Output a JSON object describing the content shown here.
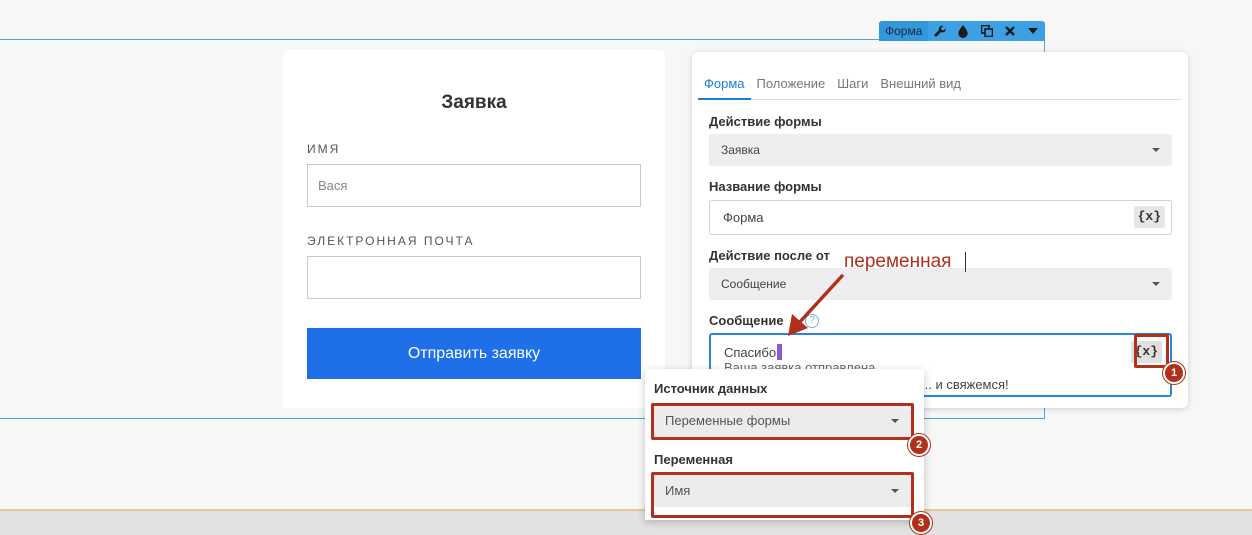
{
  "preview_form": {
    "title": "Заявка",
    "name_label": "ИМЯ",
    "name_value": "Вася",
    "email_label": "ЭЛЕКТРОННАЯ ПОЧТА",
    "email_value": "",
    "submit_label": "Отправить заявку",
    "button_color": "#1e6fe8"
  },
  "toolbar": {
    "label": "Форма",
    "icons": [
      "wrench-icon",
      "drop-icon",
      "copy-icon",
      "close-icon",
      "caret-down-icon"
    ]
  },
  "panel": {
    "tabs": [
      {
        "label": "Форма",
        "active": true
      },
      {
        "label": "Положение",
        "active": false
      },
      {
        "label": "Шаги",
        "active": false
      },
      {
        "label": "Внешний вид",
        "active": false
      }
    ],
    "form_action_label": "Действие формы",
    "form_action_value": "Заявка",
    "form_name_label": "Название формы",
    "form_name_value": "Форма",
    "var_button": "{x}",
    "after_submit_label": "Действие после от",
    "after_submit_value": "Сообщение",
    "message_label": "Сообщение",
    "message_line1": "Спасибо",
    "message_line2": "Ваша заявка отправлена",
    "message_line3": "... и свяжемся!"
  },
  "annotation": {
    "text": "переменная",
    "color": "#b1301b",
    "badges": [
      "1",
      "2",
      "3"
    ]
  },
  "dropdown": {
    "source_label": "Источник данных",
    "source_value": "Переменные формы",
    "variable_label": "Переменная",
    "variable_value": "Имя"
  }
}
